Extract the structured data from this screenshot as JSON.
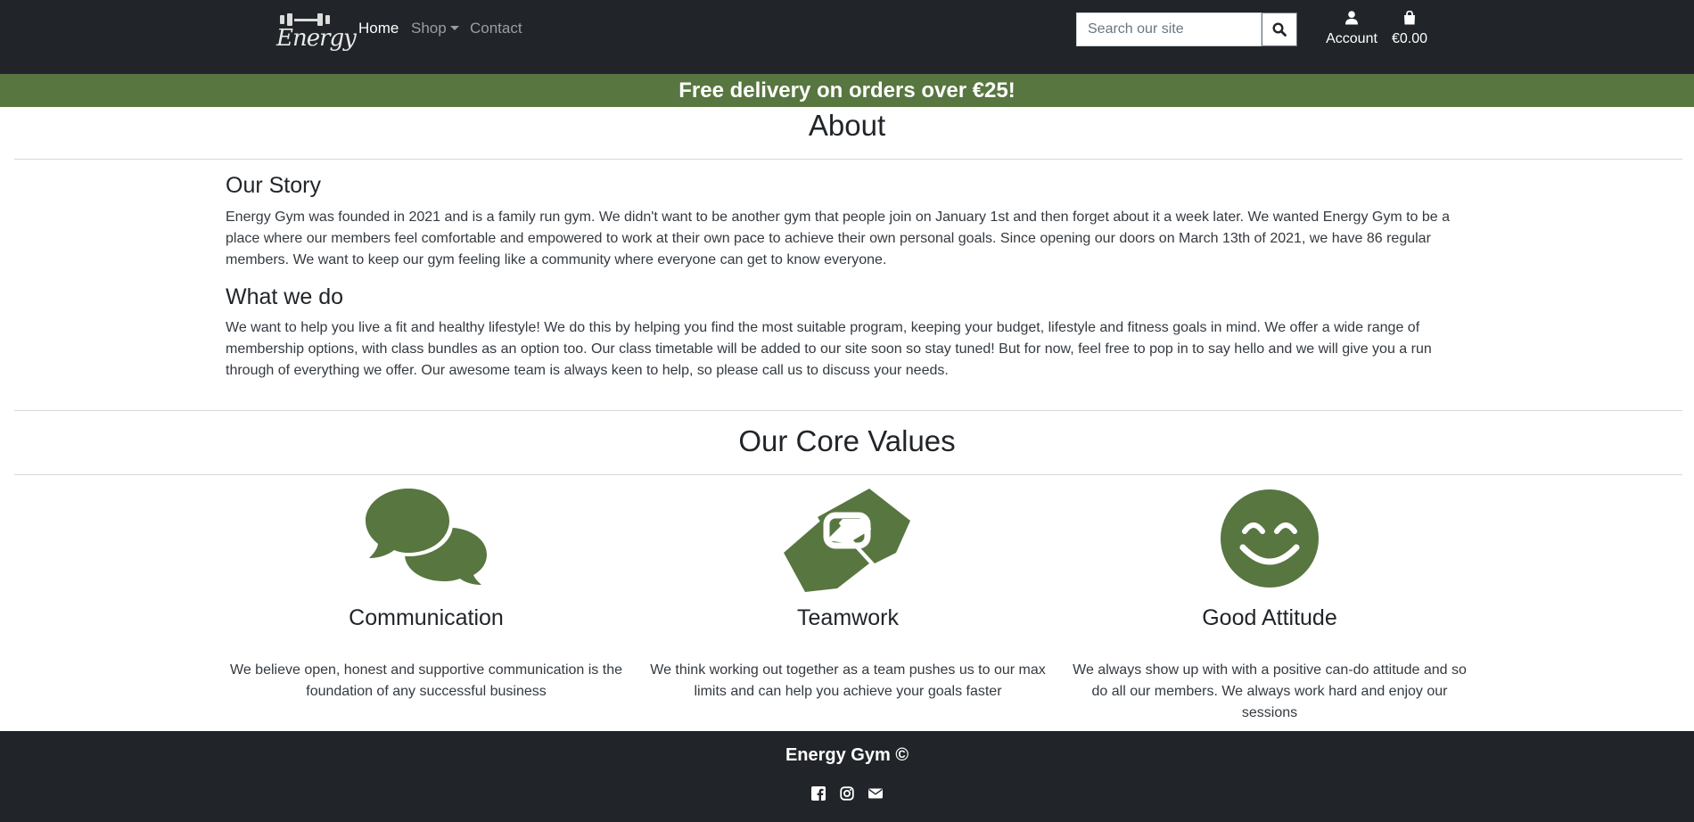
{
  "header": {
    "logo_text": "Energy",
    "nav": [
      {
        "label": "Home"
      },
      {
        "label": "Shop"
      },
      {
        "label": "Contact"
      }
    ],
    "search": {
      "placeholder": "Search our site"
    },
    "account_label": "Account",
    "cart_total": "€0.00"
  },
  "banner": {
    "text": "Free delivery on orders over €25!"
  },
  "about": {
    "title": "About",
    "story_heading": "Our Story",
    "story_text": "Energy Gym was founded in 2021 and is a family run gym. We didn't want to be another gym that people join on January 1st and then forget about it a week later. We wanted Energy Gym to be a place where our members feel comfortable and empowered to work at their own pace to achieve their own personal goals. Since opening our doors on March 13th of 2021, we have 86 regular members. We want to keep our gym feeling like a community where everyone can get to know everyone.",
    "what_heading": "What we do",
    "what_text": "We want to help you live a fit and healthy lifestyle! We do this by helping you find the most suitable program, keeping your budget, lifestyle and fitness goals in mind. We offer a wide range of membership options, with class bundles as an option too. Our class timetable will be added to our site soon so stay tuned! But for now, feel free to pop in to say hello and we will give you a run through of everything we offer. Our awesome team is always keen to help, so please call us to discuss your needs."
  },
  "core_values": {
    "title": "Our Core Values",
    "items": [
      {
        "icon": "comments-icon",
        "name": "Communication",
        "text": "We believe open, honest and supportive communication is the foundation of any successful business"
      },
      {
        "icon": "handshake-icon",
        "name": "Teamwork",
        "text": "We think working out together as a team pushes us to our max limits and can help you achieve your goals faster"
      },
      {
        "icon": "smile-icon",
        "name": "Good Attitude",
        "text": "We always show up with with a positive can-do attitude and so do all our members. We always work hard and enjoy our sessions"
      }
    ]
  },
  "footer": {
    "title": "Energy Gym ©",
    "icons": [
      "facebook-icon",
      "instagram-icon",
      "envelope-icon"
    ]
  },
  "colors": {
    "brand_green": "#587640",
    "dark": "#212529"
  }
}
